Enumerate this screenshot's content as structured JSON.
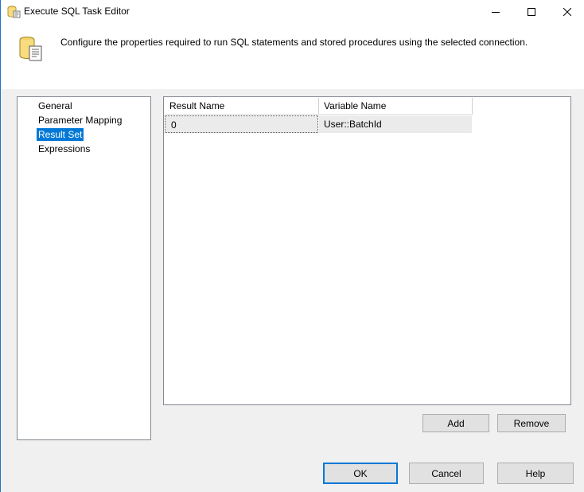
{
  "window": {
    "title": "Execute SQL Task Editor"
  },
  "header": {
    "description": "Configure the properties required to run SQL statements and stored procedures using the selected connection."
  },
  "nav": {
    "items": [
      {
        "label": "General",
        "selected": false
      },
      {
        "label": "Parameter Mapping",
        "selected": false
      },
      {
        "label": "Result Set",
        "selected": true
      },
      {
        "label": "Expressions",
        "selected": false
      }
    ]
  },
  "grid": {
    "columns": [
      "Result Name",
      "Variable Name"
    ],
    "rows": [
      {
        "result_name": "0",
        "variable_name": "User::BatchId"
      }
    ]
  },
  "buttons": {
    "add": "Add",
    "remove": "Remove",
    "ok": "OK",
    "cancel": "Cancel",
    "help": "Help"
  },
  "colors": {
    "selection": "#0078d7",
    "dialog_background": "#f0f0f0",
    "button_face": "#e1e1e1"
  }
}
